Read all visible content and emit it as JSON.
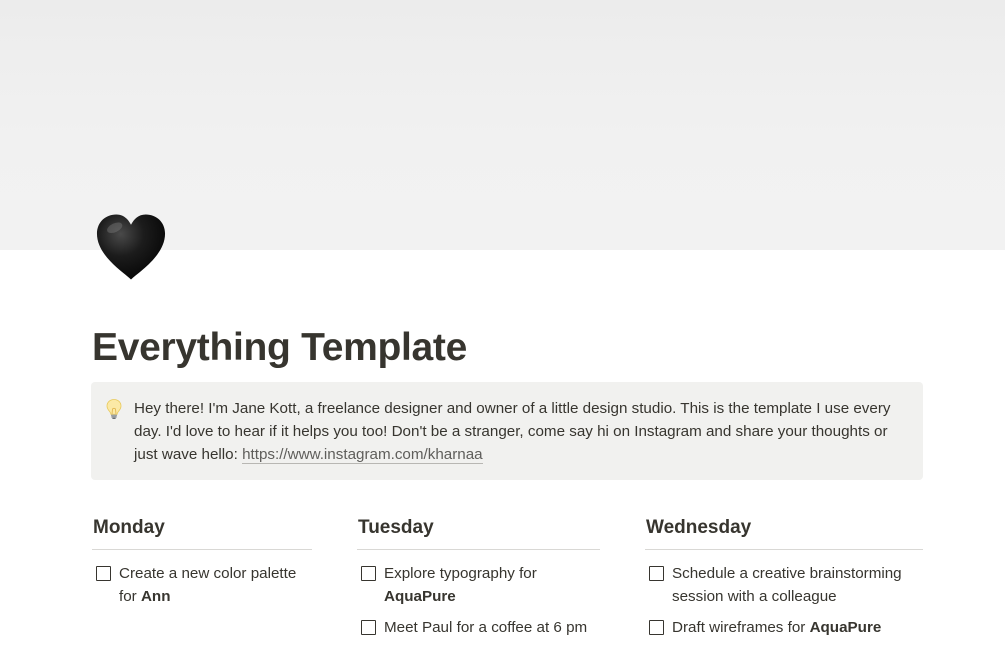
{
  "page": {
    "title": "Everything Template",
    "icon": "black-heart-icon",
    "cover_color": "#efefef"
  },
  "callout": {
    "icon": "light-bulb-icon",
    "text": "Hey there! I'm Jane Kott, a freelance designer and owner of a little design studio. This is the template I use every day. I'd love to hear if it helps you too! Don't be a stranger, come say hi on Instagram and share your thoughts or just wave hello: ",
    "link": "https://www.instagram.com/kharnaa",
    "background": "#f1f1ef"
  },
  "columns": [
    {
      "heading": "Monday",
      "todos": [
        {
          "text": "Create a new color palette for ",
          "bold": "Ann",
          "checked": false
        }
      ]
    },
    {
      "heading": "Tuesday",
      "todos": [
        {
          "text": "Explore typography for ",
          "bold": "AquaPure",
          "checked": false
        },
        {
          "text": "Meet Paul for a coffee at 6 pm",
          "bold": "",
          "checked": false
        }
      ]
    },
    {
      "heading": "Wednesday",
      "todos": [
        {
          "text": "Schedule a creative brainstorming session with a colleague",
          "bold": "",
          "checked": false
        },
        {
          "text": "Draft wireframes for ",
          "bold": "AquaPure",
          "checked": false
        }
      ]
    }
  ]
}
